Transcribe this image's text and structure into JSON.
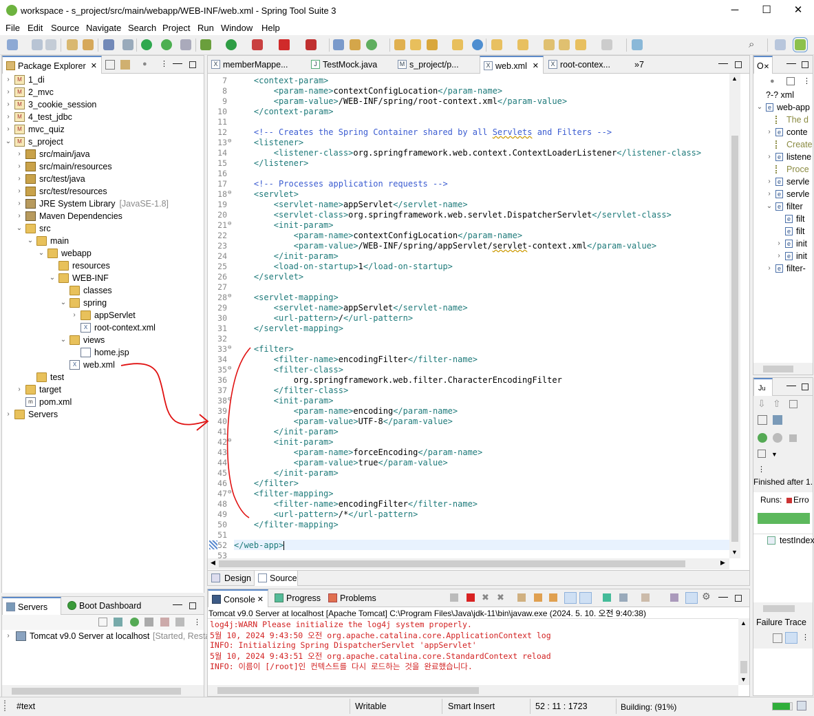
{
  "window": {
    "title": "workspace - s_project/src/main/webapp/WEB-INF/web.xml - Spring Tool Suite 3",
    "minimize": "─",
    "maximize": "☐",
    "close": "✕"
  },
  "menu": [
    "File",
    "Edit",
    "Source",
    "Navigate",
    "Search",
    "Project",
    "Run",
    "Window",
    "Help"
  ],
  "package_explorer": {
    "tab_label": "Package Explorer",
    "tree": [
      {
        "label": "1_di",
        "extra": ""
      },
      {
        "label": "2_mvc",
        "extra": ""
      },
      {
        "label": "3_cookie_session",
        "extra": ""
      },
      {
        "label": "4_test_jdbc",
        "extra": ""
      },
      {
        "label": "mvc_quiz",
        "extra": ""
      },
      {
        "label": "s_project",
        "extra": ""
      },
      {
        "label": "src/main/java",
        "extra": ""
      },
      {
        "label": "src/main/resources",
        "extra": ""
      },
      {
        "label": "src/test/java",
        "extra": ""
      },
      {
        "label": "src/test/resources",
        "extra": ""
      },
      {
        "label": "JRE System Library",
        "extra": "[JavaSE-1.8]"
      },
      {
        "label": "Maven Dependencies",
        "extra": ""
      },
      {
        "label": "src",
        "extra": ""
      },
      {
        "label": "main",
        "extra": ""
      },
      {
        "label": "webapp",
        "extra": ""
      },
      {
        "label": "resources",
        "extra": ""
      },
      {
        "label": "WEB-INF",
        "extra": ""
      },
      {
        "label": "classes",
        "extra": ""
      },
      {
        "label": "spring",
        "extra": ""
      },
      {
        "label": "appServlet",
        "extra": ""
      },
      {
        "label": "root-context.xml",
        "extra": ""
      },
      {
        "label": "views",
        "extra": ""
      },
      {
        "label": "home.jsp",
        "extra": ""
      },
      {
        "label": "web.xml",
        "extra": ""
      },
      {
        "label": "test",
        "extra": ""
      },
      {
        "label": "target",
        "extra": ""
      },
      {
        "label": "pom.xml",
        "extra": ""
      },
      {
        "label": "Servers",
        "extra": ""
      }
    ]
  },
  "editor": {
    "tabs": [
      "memberMappe...",
      "TestMock.java",
      "s_project/p...",
      "web.xml",
      "root-contex...",
      "»7"
    ],
    "active_tab": "web.xml",
    "bottom_tabs": [
      "Design",
      "Source"
    ],
    "lines": [
      {
        "n": "7",
        "fold": "",
        "indent": 1,
        "parts": [
          [
            "t",
            "<context-param>"
          ]
        ]
      },
      {
        "n": "8",
        "fold": "",
        "indent": 2,
        "parts": [
          [
            "t",
            "<param-name>"
          ],
          [
            "x",
            "contextConfigLocation"
          ],
          [
            "t",
            "</param-name>"
          ]
        ]
      },
      {
        "n": "9",
        "fold": "",
        "indent": 2,
        "parts": [
          [
            "t",
            "<param-value>"
          ],
          [
            "x",
            "/WEB-INF/spring/root-context.xml"
          ],
          [
            "t",
            "</param-value>"
          ]
        ]
      },
      {
        "n": "10",
        "fold": "",
        "indent": 1,
        "parts": [
          [
            "t",
            "</context-param>"
          ]
        ]
      },
      {
        "n": "11",
        "fold": "",
        "indent": 0,
        "parts": []
      },
      {
        "n": "12",
        "fold": "",
        "indent": 1,
        "parts": [
          [
            "c",
            "<!-- Creates the Spring Container shared by all "
          ],
          [
            "cs",
            "Servlets"
          ],
          [
            "c",
            " and Filters -->"
          ]
        ]
      },
      {
        "n": "13",
        "fold": "⊖",
        "indent": 1,
        "parts": [
          [
            "t",
            "<listener>"
          ]
        ]
      },
      {
        "n": "14",
        "fold": "",
        "indent": 2,
        "parts": [
          [
            "t",
            "<listener-class>"
          ],
          [
            "x",
            "org.springframework.web.context.ContextLoaderListener"
          ],
          [
            "t",
            "</listener-class>"
          ]
        ]
      },
      {
        "n": "15",
        "fold": "",
        "indent": 1,
        "parts": [
          [
            "t",
            "</listener>"
          ]
        ]
      },
      {
        "n": "16",
        "fold": "",
        "indent": 0,
        "parts": []
      },
      {
        "n": "17",
        "fold": "",
        "indent": 1,
        "parts": [
          [
            "c",
            "<!-- Processes application requests -->"
          ]
        ]
      },
      {
        "n": "18",
        "fold": "⊖",
        "indent": 1,
        "parts": [
          [
            "t",
            "<servlet>"
          ]
        ]
      },
      {
        "n": "19",
        "fold": "",
        "indent": 2,
        "parts": [
          [
            "t",
            "<servlet-name>"
          ],
          [
            "x",
            "appServlet"
          ],
          [
            "t",
            "</servlet-name>"
          ]
        ]
      },
      {
        "n": "20",
        "fold": "",
        "indent": 2,
        "parts": [
          [
            "t",
            "<servlet-class>"
          ],
          [
            "x",
            "org.springframework.web.servlet.DispatcherServlet"
          ],
          [
            "t",
            "</servlet-class>"
          ]
        ]
      },
      {
        "n": "21",
        "fold": "⊖",
        "indent": 2,
        "parts": [
          [
            "t",
            "<init-param>"
          ]
        ]
      },
      {
        "n": "22",
        "fold": "",
        "indent": 3,
        "parts": [
          [
            "t",
            "<param-name>"
          ],
          [
            "x",
            "contextConfigLocation"
          ],
          [
            "t",
            "</param-name>"
          ]
        ]
      },
      {
        "n": "23",
        "fold": "",
        "indent": 3,
        "parts": [
          [
            "t",
            "<param-value>"
          ],
          [
            "x",
            "/WEB-INF/spring/appServlet/"
          ],
          [
            "xs",
            "servlet"
          ],
          [
            "x",
            "-context.xml"
          ],
          [
            "t",
            "</param-value>"
          ]
        ]
      },
      {
        "n": "24",
        "fold": "",
        "indent": 2,
        "parts": [
          [
            "t",
            "</init-param>"
          ]
        ]
      },
      {
        "n": "25",
        "fold": "",
        "indent": 2,
        "parts": [
          [
            "t",
            "<load-on-startup>"
          ],
          [
            "x",
            "1"
          ],
          [
            "t",
            "</load-on-startup>"
          ]
        ]
      },
      {
        "n": "26",
        "fold": "",
        "indent": 1,
        "parts": [
          [
            "t",
            "</servlet>"
          ]
        ]
      },
      {
        "n": "27",
        "fold": "",
        "indent": 0,
        "parts": []
      },
      {
        "n": "28",
        "fold": "⊖",
        "indent": 1,
        "parts": [
          [
            "t",
            "<servlet-mapping>"
          ]
        ]
      },
      {
        "n": "29",
        "fold": "",
        "indent": 2,
        "parts": [
          [
            "t",
            "<servlet-name>"
          ],
          [
            "x",
            "appServlet"
          ],
          [
            "t",
            "</servlet-name>"
          ]
        ]
      },
      {
        "n": "30",
        "fold": "",
        "indent": 2,
        "parts": [
          [
            "t",
            "<url-pattern>"
          ],
          [
            "x",
            "/"
          ],
          [
            "t",
            "</url-pattern>"
          ]
        ]
      },
      {
        "n": "31",
        "fold": "",
        "indent": 1,
        "parts": [
          [
            "t",
            "</servlet-mapping>"
          ]
        ]
      },
      {
        "n": "32",
        "fold": "",
        "indent": 0,
        "parts": []
      },
      {
        "n": "33",
        "fold": "⊖",
        "indent": 1,
        "parts": [
          [
            "t",
            "<filter>"
          ]
        ]
      },
      {
        "n": "34",
        "fold": "",
        "indent": 2,
        "parts": [
          [
            "t",
            "<filter-name>"
          ],
          [
            "x",
            "encodingFilter"
          ],
          [
            "t",
            "</filter-name>"
          ]
        ]
      },
      {
        "n": "35",
        "fold": "⊖",
        "indent": 2,
        "parts": [
          [
            "t",
            "<filter-class>"
          ]
        ]
      },
      {
        "n": "36",
        "fold": "",
        "indent": 3,
        "parts": [
          [
            "x",
            "org.springframework.web.filter.CharacterEncodingFilter"
          ]
        ]
      },
      {
        "n": "37",
        "fold": "",
        "indent": 2,
        "parts": [
          [
            "t",
            "</filter-class>"
          ]
        ]
      },
      {
        "n": "38",
        "fold": "⊖",
        "indent": 2,
        "parts": [
          [
            "t",
            "<init-param>"
          ]
        ]
      },
      {
        "n": "39",
        "fold": "",
        "indent": 3,
        "parts": [
          [
            "t",
            "<param-name>"
          ],
          [
            "x",
            "encoding"
          ],
          [
            "t",
            "</param-name>"
          ]
        ]
      },
      {
        "n": "40",
        "fold": "",
        "indent": 3,
        "parts": [
          [
            "t",
            "<param-value>"
          ],
          [
            "x",
            "UTF-8"
          ],
          [
            "t",
            "</param-value>"
          ]
        ]
      },
      {
        "n": "41",
        "fold": "",
        "indent": 2,
        "parts": [
          [
            "t",
            "</init-param>"
          ]
        ]
      },
      {
        "n": "42",
        "fold": "⊖",
        "indent": 2,
        "parts": [
          [
            "t",
            "<init-param>"
          ]
        ]
      },
      {
        "n": "43",
        "fold": "",
        "indent": 3,
        "parts": [
          [
            "t",
            "<param-name>"
          ],
          [
            "x",
            "forceEncoding"
          ],
          [
            "t",
            "</param-name>"
          ]
        ]
      },
      {
        "n": "44",
        "fold": "",
        "indent": 3,
        "parts": [
          [
            "t",
            "<param-value>"
          ],
          [
            "x",
            "true"
          ],
          [
            "t",
            "</param-value>"
          ]
        ]
      },
      {
        "n": "45",
        "fold": "",
        "indent": 2,
        "parts": [
          [
            "t",
            "</init-param>"
          ]
        ]
      },
      {
        "n": "46",
        "fold": "",
        "indent": 1,
        "parts": [
          [
            "t",
            "</filter>"
          ]
        ]
      },
      {
        "n": "47",
        "fold": "⊖",
        "indent": 1,
        "parts": [
          [
            "t",
            "<filter-mapping>"
          ]
        ]
      },
      {
        "n": "48",
        "fold": "",
        "indent": 2,
        "parts": [
          [
            "t",
            "<filter-name>"
          ],
          [
            "x",
            "encodingFilter"
          ],
          [
            "t",
            "</filter-name>"
          ]
        ]
      },
      {
        "n": "49",
        "fold": "",
        "indent": 2,
        "parts": [
          [
            "t",
            "<url-pattern>"
          ],
          [
            "x",
            "/*"
          ],
          [
            "t",
            "</url-pattern>"
          ]
        ]
      },
      {
        "n": "50",
        "fold": "",
        "indent": 1,
        "parts": [
          [
            "t",
            "</filter-mapping>"
          ]
        ]
      },
      {
        "n": "51",
        "fold": "",
        "indent": 0,
        "parts": []
      },
      {
        "n": "52",
        "fold": "",
        "indent": 0,
        "parts": [
          [
            "t",
            "</web-app>"
          ]
        ]
      },
      {
        "n": "53",
        "fold": "",
        "indent": 0,
        "parts": []
      }
    ]
  },
  "outline": {
    "tab_label": "O",
    "items": [
      "?-? xml",
      "web-app",
      "The d",
      "conte",
      "Create",
      "listene",
      "Proce",
      "servle",
      "servle",
      "filter",
      "filt",
      "filt",
      "init",
      "init",
      "filter-"
    ]
  },
  "junit": {
    "tab_label": "J",
    "finished": "Finished after 1.",
    "runs_label": "Runs:",
    "errors_label": "Erro",
    "test_item": "testIndex",
    "failure_trace": "Failure Trace"
  },
  "servers": {
    "tabs": [
      "Servers",
      "Boot Dashboard"
    ],
    "server_name": "Tomcat v9.0 Server at localhost",
    "server_state": "[Started, Resta"
  },
  "console": {
    "tabs": [
      "Console",
      "Progress",
      "Problems"
    ],
    "header": "Tomcat v9.0 Server at localhost [Apache Tomcat] C:\\Program Files\\Java\\jdk-11\\bin\\javaw.exe  (2024. 5. 10. 오전 9:40:38)",
    "lines": [
      "log4j:WARN Please initialize the log4j system properly.",
      "5월 10, 2024 9:43:50 오전 org.apache.catalina.core.ApplicationContext log",
      "INFO: Initializing Spring DispatcherServlet 'appServlet'",
      "5월 10, 2024 9:43:51 오전 org.apache.catalina.core.StandardContext reload",
      "INFO: 이름이 [/root]인 컨텍스트를 다시 로드하는 것을 완료했습니다."
    ]
  },
  "status": {
    "left": "#text",
    "writable": "Writable",
    "insert": "Smart Insert",
    "position": "52 : 11 : 1723",
    "building": "Building: (91%)",
    "building_progress": 0.91
  },
  "colors": {
    "tag": "#1e7a7a",
    "comment": "#3b5cd1",
    "console_error": "#d22222",
    "annotation": "#e01010",
    "junit_bar": "#5cb85c"
  }
}
